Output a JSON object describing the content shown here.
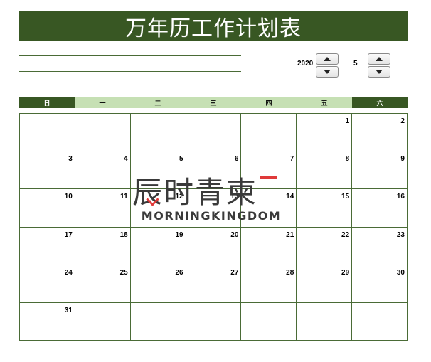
{
  "title": "万年历工作计划表",
  "year": {
    "value": "2020"
  },
  "month": {
    "value": "5"
  },
  "weekdays": [
    "日",
    "一",
    "二",
    "三",
    "四",
    "五",
    "六"
  ],
  "calendar": {
    "weeks": [
      [
        "",
        "",
        "",
        "",
        "",
        "1",
        "2"
      ],
      [
        "3",
        "4",
        "5",
        "6",
        "7",
        "8",
        "9"
      ],
      [
        "10",
        "11",
        "12",
        "13",
        "14",
        "15",
        "16"
      ],
      [
        "17",
        "18",
        "19",
        "20",
        "21",
        "22",
        "23"
      ],
      [
        "24",
        "25",
        "26",
        "27",
        "28",
        "29",
        "30"
      ],
      [
        "31",
        "",
        "",
        "",
        "",
        "",
        ""
      ]
    ]
  },
  "watermark": {
    "chinese": "辰时青柬",
    "english": "MORNINGKINGDOM"
  },
  "colors": {
    "header_dark": "#385723",
    "header_light": "#c6e0b4",
    "grid_line": "#4a6b36"
  },
  "icons": [
    "spin-up-icon",
    "spin-down-icon"
  ]
}
